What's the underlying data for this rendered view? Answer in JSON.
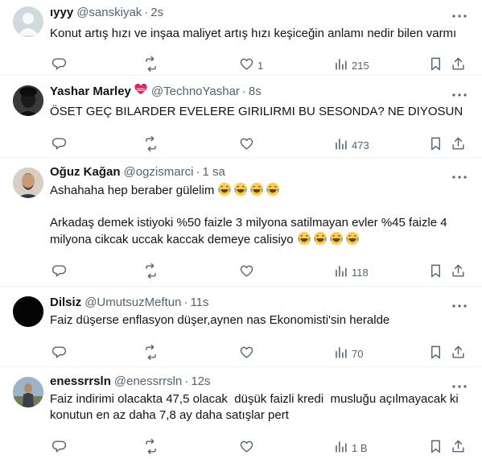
{
  "tweets": [
    {
      "name": "ıyyy",
      "handle": "@sanskiyak",
      "time": "2s",
      "text": "Konut artış hızı ve inşaa maliyet artış hızı keşiceğin anlamı nedir bilen varmı",
      "replies": "",
      "retweets": "",
      "likes": "1",
      "views": "215"
    },
    {
      "name": "Yashar Marley",
      "handle": "@TechnoYashar",
      "time": "8s",
      "text": "ÖSET GEÇ BILARDER EVELERE GIRILIRMI BU SESONDA? NE DIYOSUN",
      "replies": "",
      "retweets": "",
      "likes": "",
      "views": "473"
    },
    {
      "name": "Oğuz Kağan",
      "handle": "@ogzismarci",
      "time": "1 sa",
      "text_line1": "Ashahaha hep beraber gülelim",
      "text_line2": "Arkadaş demek istiyoki %50 faizle 3 milyona satilmayan evler %45 faizle 4",
      "text_line3": "milyona cikcak uccak kaccak demeye calisiyo",
      "replies": "",
      "retweets": "",
      "likes": "",
      "views": "118"
    },
    {
      "name": "Dilsiz",
      "handle": "@UmutsuzMeftun",
      "time": "11s",
      "text": "Faiz düşerse enflasyon düşer,aynen nas Ekonomisti'sin heralde",
      "replies": "",
      "retweets": "",
      "likes": "",
      "views": "70"
    },
    {
      "name": "enessrrsln",
      "handle": "@enessrrsln",
      "time": "12s",
      "text_line1": "Faiz indirimi olacakta 47,5 olacak  düşük faizli kredi  musluğu açılmayacak ki",
      "text_line2": "konutun en az daha 7,8 ay daha satışlar pert",
      "replies": "",
      "retweets": "",
      "likes": "",
      "views": "1 B"
    }
  ],
  "separator": "·",
  "icons": [
    "more-icon",
    "reply-icon",
    "retweet-icon",
    "like-icon",
    "views-icon",
    "bookmark-icon",
    "share-icon",
    "heart-badge-icon",
    "laughing-emoji-icon"
  ],
  "colors": {
    "text": "#0f1419",
    "secondary": "#536471",
    "divider": "#eff3f4",
    "badge_red": "#e0245e"
  }
}
